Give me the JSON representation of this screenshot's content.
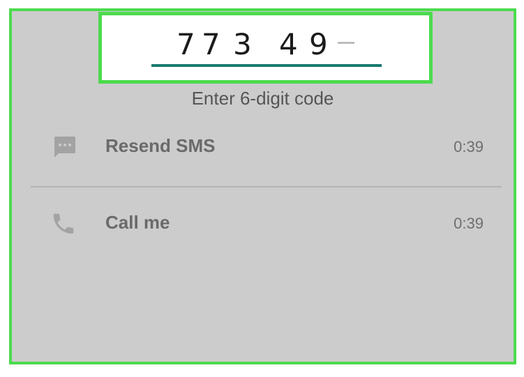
{
  "verification": {
    "code_digits": [
      "7",
      "7",
      "3",
      "4",
      "9"
    ],
    "prompt": "Enter 6-digit code"
  },
  "options": [
    {
      "label": "Resend SMS",
      "timer": "0:39",
      "icon": "sms-icon"
    },
    {
      "label": "Call me",
      "timer": "0:39",
      "icon": "phone-icon"
    }
  ],
  "colors": {
    "highlight": "#4cdb4f",
    "underline": "#167a6f",
    "background": "#cccccc",
    "icon": "#a3a3a3"
  }
}
